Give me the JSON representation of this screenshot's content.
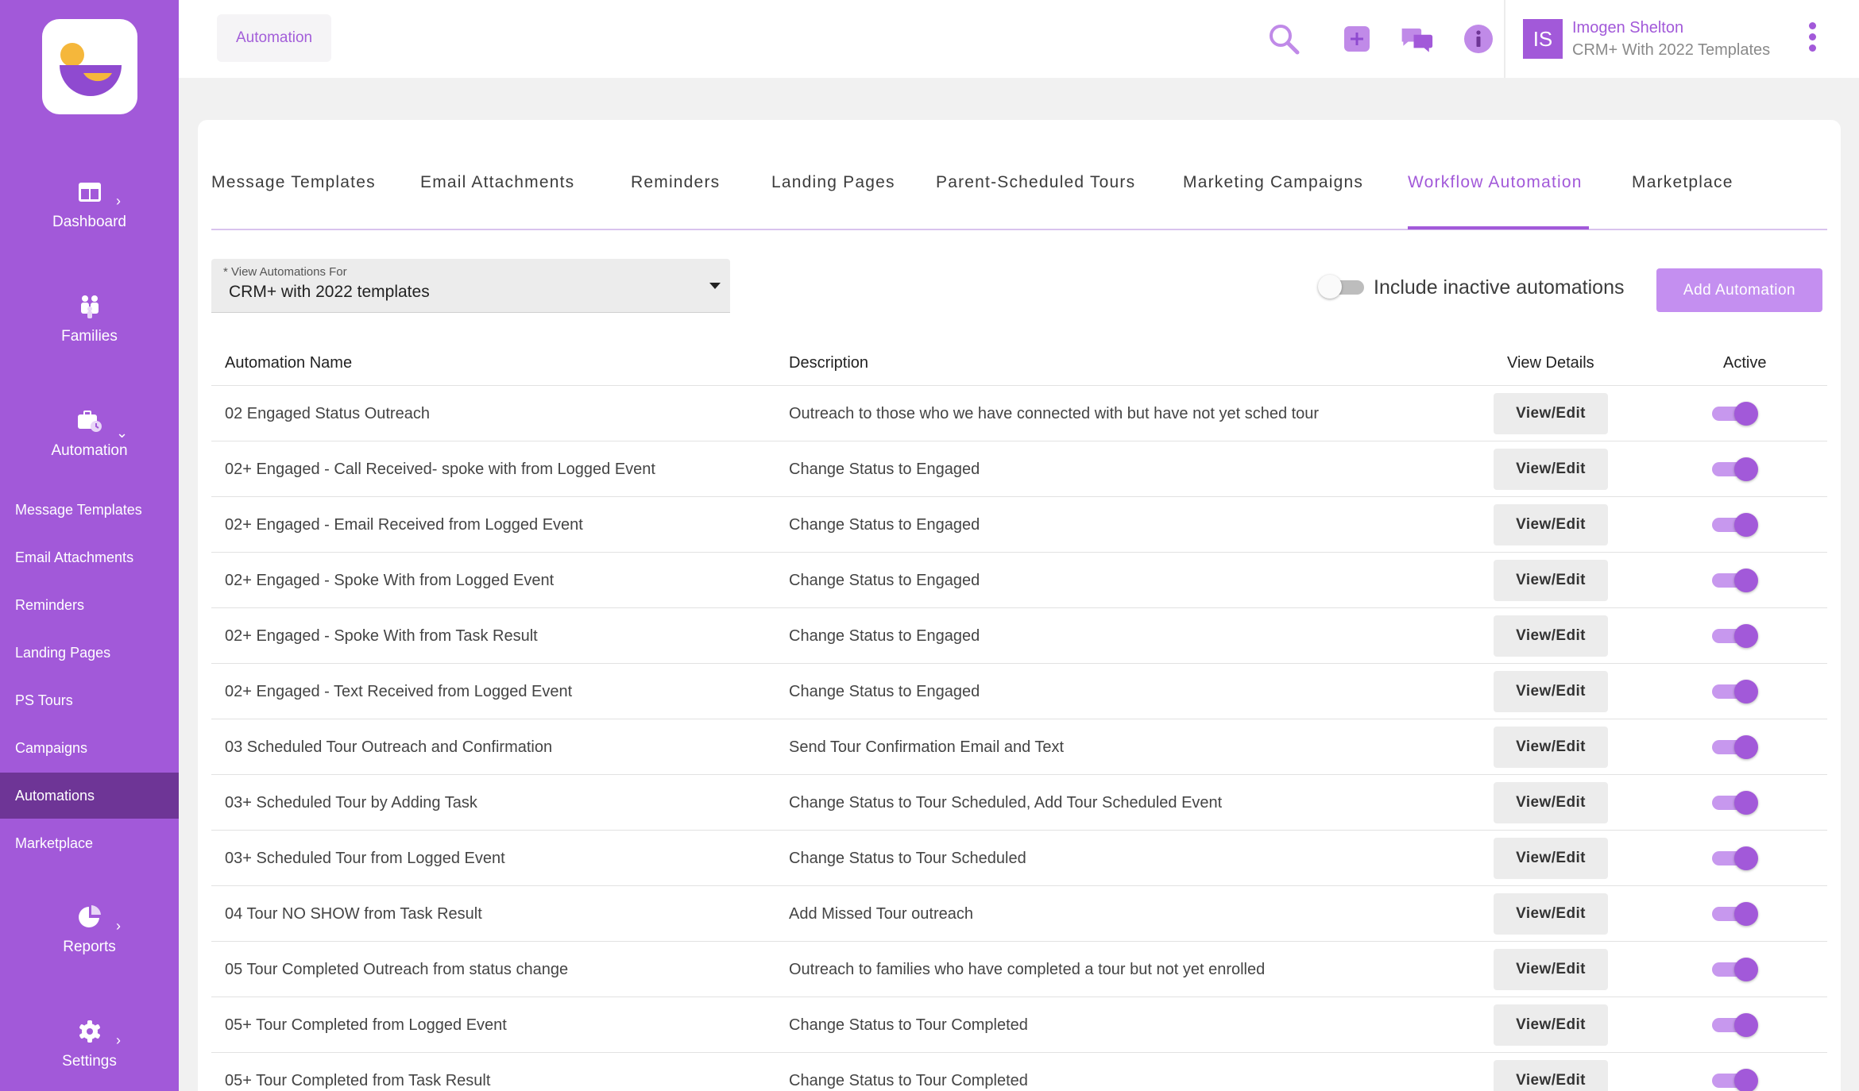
{
  "colors": {
    "brand": "#a259d9",
    "sidebar_active": "#6e3596",
    "button_primary": "#c48ff0"
  },
  "sidebar": {
    "main": [
      {
        "label": "Dashboard",
        "icon": "dashboard-icon"
      },
      {
        "label": "Families",
        "icon": "families-icon"
      },
      {
        "label": "Automation",
        "icon": "automation-icon"
      },
      {
        "label": "Reports",
        "icon": "reports-icon"
      },
      {
        "label": "Settings",
        "icon": "settings-icon"
      }
    ],
    "sub": [
      {
        "label": "Message Templates"
      },
      {
        "label": "Email Attachments"
      },
      {
        "label": "Reminders"
      },
      {
        "label": "Landing Pages"
      },
      {
        "label": "PS Tours"
      },
      {
        "label": "Campaigns"
      },
      {
        "label": "Automations",
        "active": true
      },
      {
        "label": "Marketplace"
      }
    ]
  },
  "header": {
    "breadcrumb": "Automation",
    "icons": [
      "search-icon",
      "add-icon",
      "chat-icon",
      "info-icon"
    ],
    "user": {
      "initials": "IS",
      "name": "Imogen Shelton",
      "org": "CRM+ With 2022 Templates"
    }
  },
  "tabs": [
    {
      "label": "Message Templates"
    },
    {
      "label": "Email Attachments"
    },
    {
      "label": "Reminders"
    },
    {
      "label": "Landing Pages"
    },
    {
      "label": "Parent-Scheduled Tours"
    },
    {
      "label": "Marketing Campaigns"
    },
    {
      "label": "Workflow Automation",
      "active": true
    },
    {
      "label": "Marketplace"
    }
  ],
  "filter": {
    "label": "* View Automations For",
    "value": "CRM+ with 2022 templates",
    "include_inactive_label": "Include inactive automations",
    "include_inactive": false,
    "add_button": "Add Automation"
  },
  "table": {
    "columns": [
      "Automation Name",
      "Description",
      "View Details",
      "Active"
    ],
    "button_label": "View/Edit",
    "rows": [
      {
        "name": "02 Engaged Status Outreach",
        "description": "Outreach to those who we have connected with but have not yet sched tour",
        "active": true
      },
      {
        "name": "02+ Engaged - Call Received- spoke with from Logged Event",
        "description": "Change Status to Engaged",
        "active": true
      },
      {
        "name": "02+ Engaged - Email Received from Logged Event",
        "description": "Change Status to Engaged",
        "active": true
      },
      {
        "name": "02+ Engaged - Spoke With from Logged Event",
        "description": "Change Status to Engaged",
        "active": true
      },
      {
        "name": "02+ Engaged - Spoke With from Task Result",
        "description": "Change Status to Engaged",
        "active": true
      },
      {
        "name": "02+ Engaged - Text Received from Logged Event",
        "description": "Change Status to Engaged",
        "active": true
      },
      {
        "name": "03 Scheduled Tour Outreach and Confirmation",
        "description": "Send Tour Confirmation Email and Text",
        "active": true
      },
      {
        "name": "03+ Scheduled Tour by Adding Task",
        "description": "Change Status to Tour Scheduled, Add Tour Scheduled Event",
        "active": true
      },
      {
        "name": "03+ Scheduled Tour from Logged Event",
        "description": "Change Status to Tour Scheduled",
        "active": true
      },
      {
        "name": "04 Tour NO SHOW from Task Result",
        "description": "Add Missed Tour outreach",
        "active": true
      },
      {
        "name": "05 Tour Completed Outreach from status change",
        "description": "Outreach to families who have completed a tour but not yet enrolled",
        "active": true
      },
      {
        "name": "05+ Tour Completed from Logged Event",
        "description": "Change Status to Tour Completed",
        "active": true
      },
      {
        "name": "05+ Tour Completed from Task Result",
        "description": "Change Status to Tour Completed",
        "active": true
      }
    ]
  }
}
